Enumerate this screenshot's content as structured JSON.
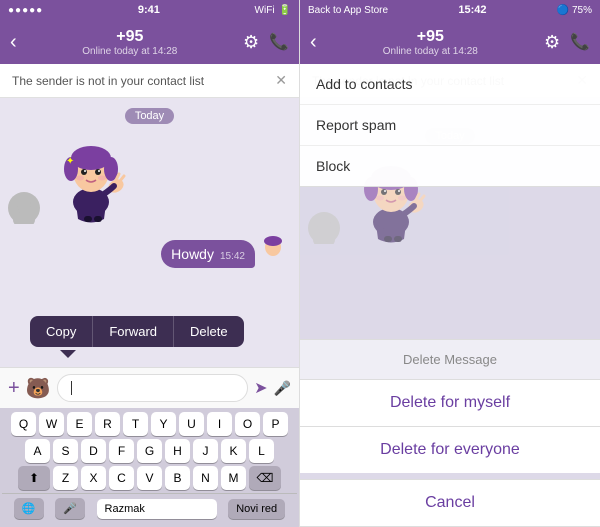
{
  "left": {
    "statusBar": {
      "signal": "●●●●●",
      "time": "9:41",
      "wifi": "WiFi",
      "battery": "🔋"
    },
    "navBar": {
      "backArrow": "‹",
      "contact": "+95",
      "subtitle": "Online today at 14:28",
      "gearIcon": "⚙",
      "phoneIcon": "📞"
    },
    "notification": "The sender is not in your contact list",
    "notifClose": "✕",
    "dateBadge": "Today",
    "contextMenu": {
      "copy": "Copy",
      "forward": "Forward",
      "delete": "Delete"
    },
    "howdyMsg": "Howdy",
    "msgTime": "15:42",
    "inputPlaceholder": "|",
    "plusIcon": "+",
    "stickerIcon": "🐻",
    "sendIcon": "➤",
    "micIcon": "🎤",
    "keyboard": {
      "row1": [
        "Q",
        "W",
        "E",
        "R",
        "T",
        "Y",
        "U",
        "I",
        "O",
        "P"
      ],
      "row2": [
        "A",
        "S",
        "D",
        "F",
        "G",
        "H",
        "J",
        "K",
        "L"
      ],
      "row3": [
        "Z",
        "X",
        "C",
        "V",
        "B",
        "N",
        "M"
      ],
      "bottomLeft": "🌐",
      "bottomMic": "🎤",
      "space": "Razmak",
      "newline": "Novi red",
      "shift": "⬆",
      "backspace": "⌫"
    }
  },
  "right": {
    "statusBar": {
      "left": "Back to App Store",
      "time": "15:42",
      "icons": "🔵 75%"
    },
    "navBar": {
      "backArrow": "‹",
      "contact": "+95",
      "subtitle": "Online today at 14:28",
      "gearIcon": "⚙",
      "phoneIcon": "📞"
    },
    "notification": "The sender is not in your contact list",
    "notifClose": "✕",
    "dropdown": {
      "items": [
        "Add to contacts",
        "Report spam",
        "Block"
      ]
    },
    "dateBadge": "Today",
    "modal": {
      "title": "Delete Message",
      "deleteForMyself": "Delete for myself",
      "deleteForEveryone": "Delete for everyone",
      "cancel": "Cancel"
    }
  }
}
